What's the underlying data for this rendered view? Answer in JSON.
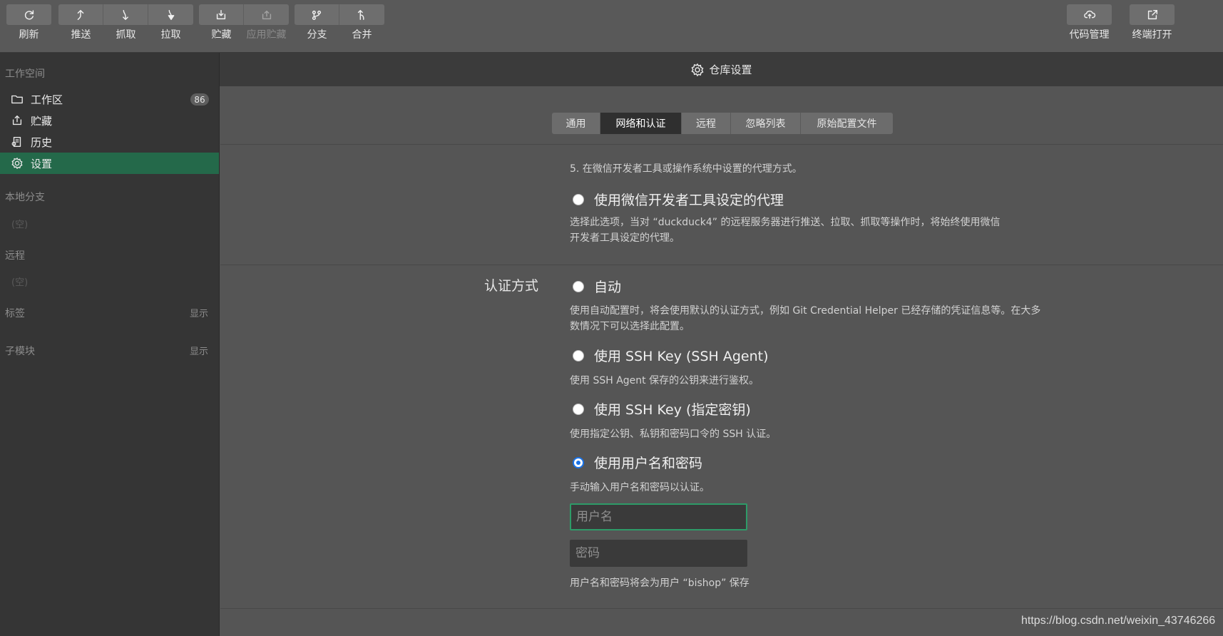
{
  "toolbar": {
    "left_groups": [
      [
        {
          "label": "刷新",
          "icon": "refresh-icon"
        }
      ],
      [
        {
          "label": "推送",
          "icon": "push-icon"
        },
        {
          "label": "抓取",
          "icon": "fetch-icon"
        },
        {
          "label": "拉取",
          "icon": "pull-icon"
        }
      ],
      [
        {
          "label": "贮藏",
          "icon": "stash-icon"
        },
        {
          "label": "应用贮藏",
          "icon": "apply-stash-icon",
          "disabled": true
        }
      ],
      [
        {
          "label": "分支",
          "icon": "branch-icon"
        },
        {
          "label": "合并",
          "icon": "merge-icon"
        }
      ]
    ],
    "code_manage": "代码管理",
    "terminal_open": "终端打开"
  },
  "sidebar": {
    "workspace_title": "工作空间",
    "items": [
      {
        "label": "工作区",
        "icon": "folder-icon",
        "badge": "86"
      },
      {
        "label": "贮藏",
        "icon": "stash-icon"
      },
      {
        "label": "历史",
        "icon": "history-icon"
      },
      {
        "label": "设置",
        "icon": "gear-icon",
        "active": true
      }
    ],
    "local_branch_title": "本地分支",
    "local_branch_empty": "(空)",
    "remote_title": "远程",
    "remote_empty": "(空)",
    "tags_title": "标签",
    "tags_show": "显示",
    "submodule_title": "子模块",
    "submodule_show": "显示"
  },
  "header": {
    "title": "仓库设置"
  },
  "tabs": [
    {
      "label": "通用",
      "active": false
    },
    {
      "label": "网络和认证",
      "active": true
    },
    {
      "label": "远程",
      "active": false
    },
    {
      "label": "忽略列表",
      "active": false
    },
    {
      "label": "原始配置文件",
      "active": false
    }
  ],
  "proxy": {
    "note": "5. 在微信开发者工具或操作系统中设置的代理方式。",
    "option_label": "使用微信开发者工具设定的代理",
    "option_desc_line1": "选择此选项，当对 “duckduck4” 的远程服务器进行推送、拉取、抓取等操作时，将始终使用微信",
    "option_desc_line2": "开发者工具设定的代理。"
  },
  "auth": {
    "label": "认证方式",
    "auto_label": "自动",
    "auto_desc_line1": "使用自动配置时，将会使用默认的认证方式，例如 Git Credential Helper 已经存储的凭证信息等。在大多",
    "auto_desc_line2": "数情况下可以选择此配置。",
    "ssh_agent_label": "使用 SSH Key (SSH Agent)",
    "ssh_agent_desc": "使用 SSH Agent 保存的公钥来进行鉴权。",
    "ssh_key_label": "使用 SSH Key (指定密钥)",
    "ssh_key_desc": "使用指定公钥、私钥和密码口令的 SSH 认证。",
    "userpass_label": "使用用户名和密码",
    "userpass_desc": "手动输入用户名和密码以认证。",
    "selected": "userpass",
    "username_placeholder": "用户名",
    "username_value": "",
    "password_placeholder": "密码",
    "password_value": "",
    "save_note": "用户名和密码将会为用户 “bishop” 保存"
  },
  "watermark": "https://blog.csdn.net/weixin_43746266",
  "colors": {
    "accent_green": "#24694a",
    "radio_blue": "#1a73e8",
    "focus_green": "#2e9b68"
  }
}
